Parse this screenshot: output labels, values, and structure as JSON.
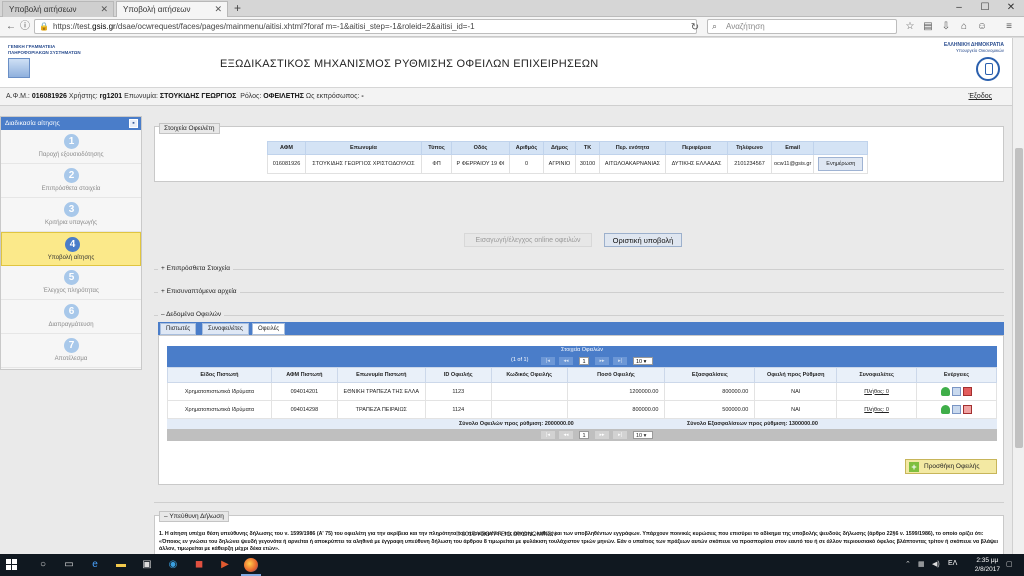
{
  "browser": {
    "tabs": [
      {
        "label": "Υποβολή αιτήσεων",
        "active": false
      },
      {
        "label": "Υποβολή αιτήσεων",
        "active": true
      }
    ],
    "new_tab": "+",
    "url_prefix": "https://test.",
    "url_host": "gsis.gr",
    "url_rest": "/dsae/ocwrequest/faces/pages/mainmenu/aitisi.xhtml?foraf m=-1&aitisi_step=-1&roleid=2&aitisi_id=-1",
    "search_placeholder": "Αναζήτηση"
  },
  "header": {
    "left_logo_lines": [
      "ΓΕΝΙΚΗ ΓΡΑΜΜΑΤΕΙΑ",
      "ΠΛΗΡΟΦΟΡΙΑΚΩΝ ΣΥΣΤΗΜΑΤΩΝ"
    ],
    "title": "ΕΞΩΔΙΚΑΣΤΙΚΟΣ ΜΗΧΑΝΙΣΜΟΣ ΡΥΘΜΙΣΗΣ ΟΦΕΙΛΩΝ ΕΠΙΧΕΙΡΗΣΕΩΝ",
    "right_logo_line1": "ΕΛΛΗΝΙΚΗ ΔΗΜΟΚΡΑΤΙΑ",
    "right_logo_line2": "Υπουργείο Οικονομικών"
  },
  "userbar": {
    "afm_label": "Α.Φ.Μ.:",
    "afm": "016081926",
    "user_label": "Χρήστης:",
    "user": "rg1201",
    "name_label": "Επωνυμία:",
    "name": "ΣΤΟΥΚΙΔΗΣ ΓΕΩΡΓΙΟΣ",
    "role_label": "Ρόλος:",
    "role": "ΟΦΕΙΛΕΤΗΣ",
    "rep_label": "Ως εκπρόσωπος:",
    "rep": "-",
    "exit": "Έξοδος"
  },
  "sidebar": {
    "title": "Διαδικασία αίτησης",
    "steps": [
      {
        "num": "1",
        "label": "Παροχή εξουσιοδότησης"
      },
      {
        "num": "2",
        "label": "Επιπρόσθετα στοιχεία"
      },
      {
        "num": "3",
        "label": "Κριτήρια υπαγωγής"
      },
      {
        "num": "4",
        "label": "Υποβολή αίτησης",
        "active": true
      },
      {
        "num": "5",
        "label": "Έλεγχος πληρότητας"
      },
      {
        "num": "6",
        "label": "Διαπραγμάτευση"
      },
      {
        "num": "7",
        "label": "Αποτέλεσμα"
      }
    ]
  },
  "debtor": {
    "legend": "Στοιχεία Οφειλέτη",
    "headers": [
      "ΑΦΜ",
      "Επωνυμία",
      "Τύπος",
      "Οδός",
      "Αριθμός",
      "Δήμος",
      "ΤΚ",
      "Περ. ενότητα",
      "Περιφέρεια",
      "Τηλέφωνο",
      "Email"
    ],
    "row": [
      "016081926",
      "ΣΤΟΥΚΙΔΗΣ ΓΕΩΡΓΙΟΣ ΧΡΙΣΤΟΔΟΥΛΟΣ",
      "ΦΠ",
      "Ρ ΦΕΡΡΑΙΟΥ 19 ΦΙ",
      "0",
      "ΑΓΡΙΝΙΟ",
      "30100",
      "ΑΙΤΩΛΟΑΚΑΡΝΑΝΙΑΣ",
      "ΔΥΤΙΚΗΣ ΕΛΛΑΔΑΣ",
      "2101234567",
      "ocw11@gsis.gr"
    ],
    "update_button": "Ενημέρωση"
  },
  "actions": {
    "import_button": "Εισαγωγή/έλεγχος online οφειλών",
    "submit_button": "Οριστική υποβολή"
  },
  "sections": {
    "extra": "Επιπρόσθετα Στοιχεία",
    "attachments": "Επισυναπτόμενα αρχεία",
    "debt_data": "Δεδομένα Οφειλών"
  },
  "tabs": [
    {
      "label": "Πιστωτές",
      "active": false
    },
    {
      "label": "Συνοφειλέτες",
      "active": false
    },
    {
      "label": "Οφειλές",
      "active": true
    }
  ],
  "grid": {
    "title": "Στοιχεία Οφειλών",
    "page_info": "(1 of 1)",
    "page": "1",
    "rows_per_page": "10",
    "headers": [
      "Είδος Πιστωτή",
      "ΑΦΜ Πιστωτή",
      "Επωνυμία Πιστωτή",
      "ID Οφειλής",
      "Κωδικός Οφειλής",
      "Ποσό Οφειλής",
      "Εξασφαλίσεις",
      "Οφειλή προς Ρύθμιση",
      "Συνοφειλέτες",
      "Ενέργειες"
    ],
    "rows": [
      {
        "type": "Χρηματοπιστωτικά Ιδρύματα",
        "afm": "094014201",
        "name": "ΕΘΝΙΚΗ ΤΡΑΠΕΖΑ ΤΗΣ ΕΛΛΑ",
        "id": "1123",
        "code": "",
        "amount": "1200000.00",
        "collateral": "800000.00",
        "to_settle": "ΝΑΙ",
        "codebtors": "Πλήθος: 0"
      },
      {
        "type": "Χρηματοπιστωτικά Ιδρύματα",
        "afm": "094014298",
        "name": "ΤΡΑΠΕΖΑ ΠΕΙΡΑΙΩΣ",
        "id": "1124",
        "code": "",
        "amount": "800000.00",
        "collateral": "500000.00",
        "to_settle": "ΝΑΙ",
        "codebtors": "Πλήθος: 0"
      }
    ],
    "total_debt": "Σύνολο Οφειλών προς ρύθμιση: 2000000.00",
    "total_collateral": "Σύνολο Εξασφαλίσεων προς ρύθμιση: 1300000.00",
    "add_button": "Προσθήκη Οφειλής"
  },
  "declaration": {
    "legend": "Υπεύθυνη Δήλωση",
    "text": "1. Η αίτηση υπέχει θέση υπεύθυνης δήλωσης του ν. 1599/1986 (Α' 75) του οφειλέτη για την ακρίβεια και την πληρότητα του περιεχομένου της αίτησης, καθώς και των υποβληθέντων εγγράφων. Υπάρχουν ποινικές κυρώσεις που επισύρει το αδίκημα της υποβολής ψευδούς δήλωσης (άρθρο 22§6 ν. 1599/1986), το οποίο ορίζει ότι: «Όποιος εν γνώσει του δηλώνει ψευδή γεγονότα ή αρνείται ή αποκρύπτει τα αληθινά με έγγραφη υπεύθυνη δήλωση του άρθρου 8 τιμωρείται με φυλάκιση τουλάχιστον τριών μηνών. Εάν ο υπαίτιος των πράξεων αυτών σκόπευε να προσπορίσει στον εαυτό του ή σε άλλον περιουσιακό όφελος βλάπτοντας τρίτον ή σκόπευε να βλάψει άλλον, τιμωρείται με κάθειρξη μέχρι δέκα ετών»."
  },
  "footer": "© 2017 ΥΠΟΥΡΓΕΙΟ ΟΙΚΟΝΟΜΙΚΩΝ",
  "taskbar": {
    "time": "2:35 μμ",
    "date": "2/8/2017",
    "lang": "ΕΛ"
  }
}
